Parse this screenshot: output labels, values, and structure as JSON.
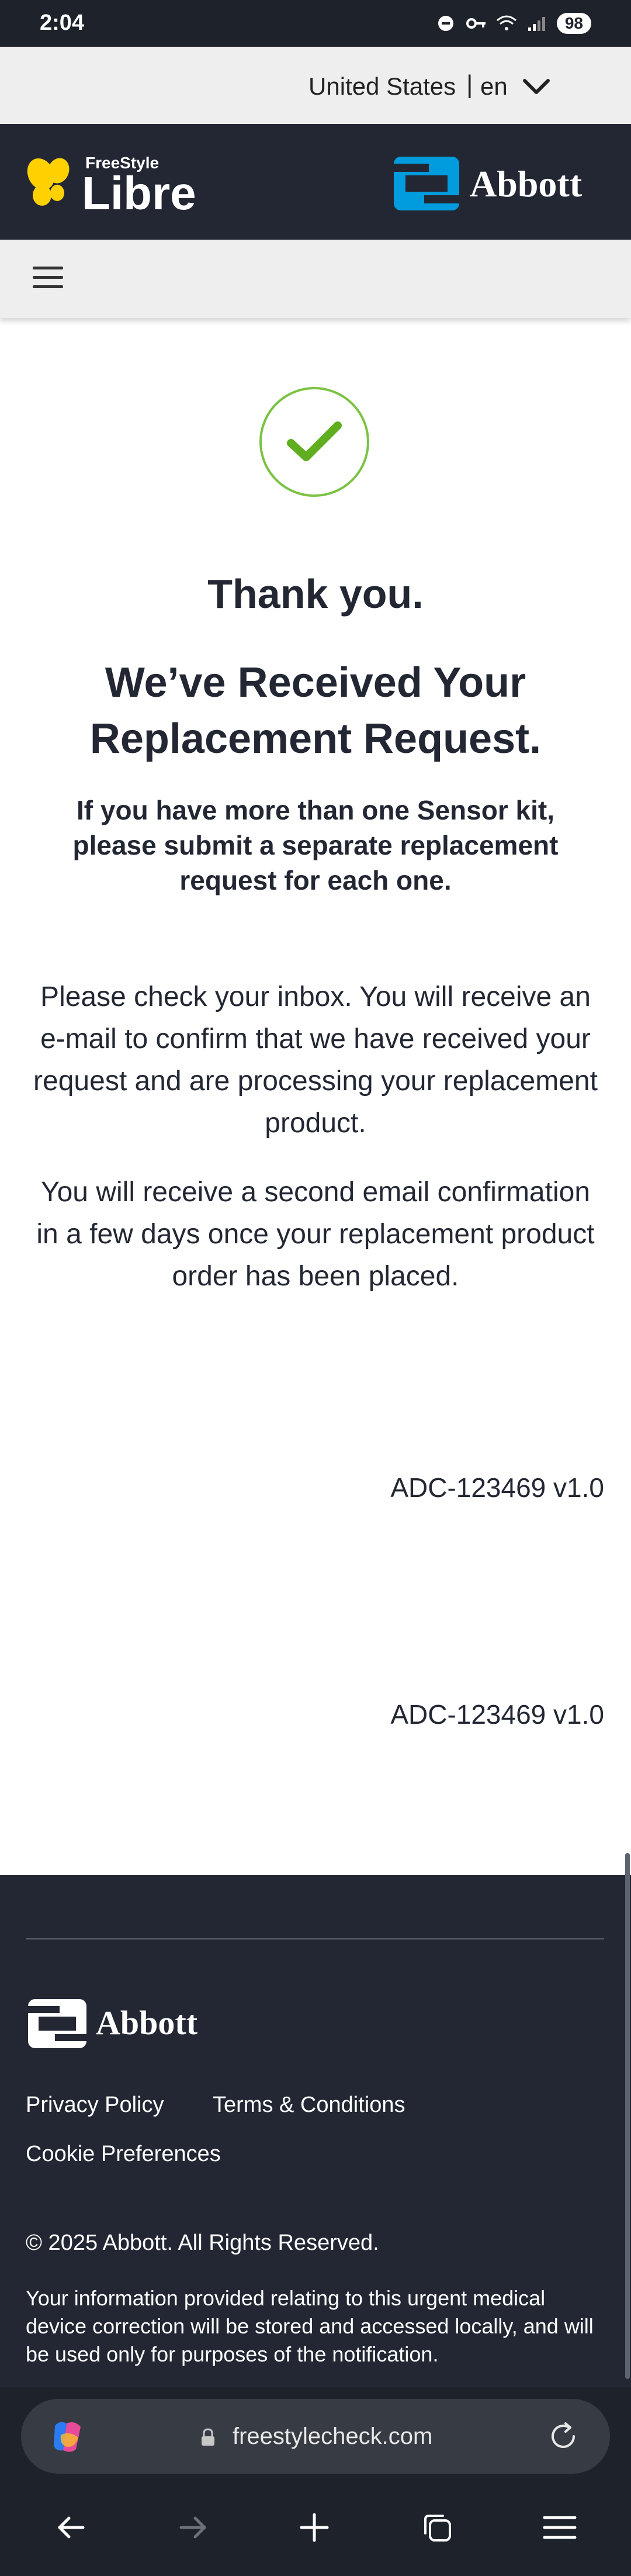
{
  "status_bar": {
    "time": "2:04",
    "battery": "98"
  },
  "locale": {
    "country": "United States",
    "separator": "|",
    "language": "en"
  },
  "brand": {
    "libre_small": "FreeStyle",
    "libre_large": "Libre",
    "abbott": "Abbott"
  },
  "content": {
    "thank_you": "Thank you.",
    "headline": "We’ve Received Your Replacement Request.",
    "subnote": "If you have more than one Sensor kit, please submit a separate replacement request for each one.",
    "para1": "Please check your inbox. You will receive an e-mail to confirm that we have received your request and are processing your replacement product.",
    "para2": "You will receive a second email confirmation in a few days once your replacement product order has been placed.",
    "version_1": "ADC-123469 v1.0",
    "version_2": "ADC-123469 v1.0"
  },
  "footer": {
    "abbott": "Abbott",
    "links": [
      "Privacy Policy",
      "Terms & Conditions",
      "Cookie Preferences"
    ],
    "copyright": "© 2025 Abbott. All Rights Reserved.",
    "disclaimer": "Your information provided relating to this urgent medical device correction will be stored and accessed locally, and will be used only for purposes of the notification."
  },
  "browser": {
    "url": "freestylecheck.com"
  },
  "nav": {
    "icons": [
      "back-arrow-icon",
      "forward-arrow-icon",
      "new-tab-plus-icon",
      "tabs-icon",
      "menu-icon"
    ]
  },
  "colors": {
    "header_bg": "#222733",
    "accent_green": "#7bc243",
    "abbott_blue": "#009cde",
    "libre_yellow": "#ffd100"
  }
}
